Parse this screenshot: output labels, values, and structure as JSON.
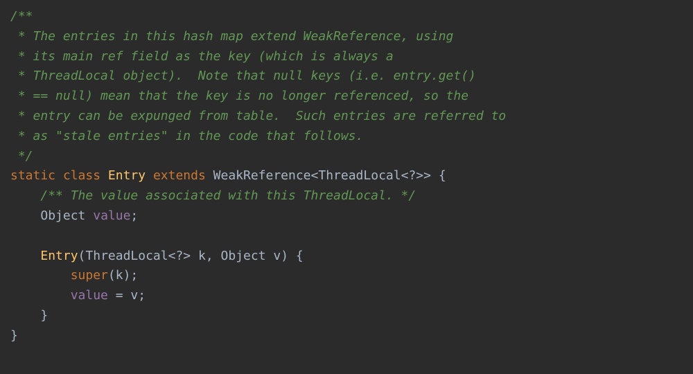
{
  "code": {
    "comment_open": "/**",
    "comment_line1": " * The entries in this hash map extend WeakReference, using",
    "comment_line2": " * its main ref field as the key (which is always a",
    "comment_line3": " * ThreadLocal object).  Note that null keys (i.e. entry.get()",
    "comment_line4": " * == null) mean that the key is no longer referenced, so the",
    "comment_line5": " * entry can be expunged from table.  Such entries are referred to",
    "comment_line6": " * as \"stale entries\" in the code that follows.",
    "comment_close": " */",
    "kw_static": "static",
    "kw_class": "class",
    "class_entry": "Entry",
    "kw_extends": "extends",
    "type_weakref": "WeakReference",
    "type_threadlocal": "ThreadLocal",
    "generic_open": "<",
    "generic_wild": "?",
    "generic_close": ">",
    "generic_close2": ">",
    "brace_open": "{",
    "inner_comment": "/** The value associated with this ThreadLocal. */",
    "type_object": "Object",
    "field_value": "value",
    "semicolon": ";",
    "ctor_name": "Entry",
    "paren_open": "(",
    "param_type1": "ThreadLocal",
    "param_k": "k",
    "comma": ",",
    "param_type2": "Object",
    "param_v": "v",
    "paren_close": ")",
    "kw_super": "super",
    "assign": "=",
    "brace_close": "}"
  }
}
